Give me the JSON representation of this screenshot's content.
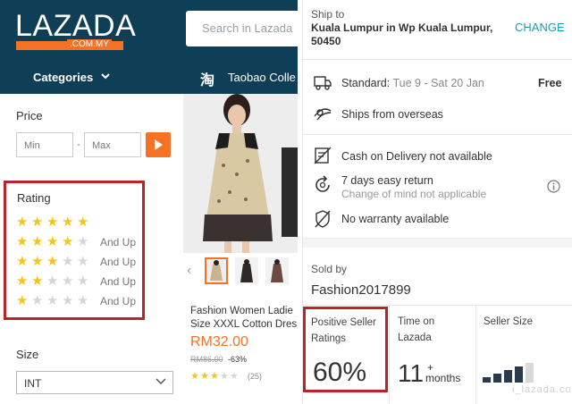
{
  "header": {
    "logo_text": "LAZADA",
    "logo_sub": ".COM.MY",
    "search_placeholder": "Search in Lazada",
    "categories_label": "Categories",
    "taobao_icon_glyph": "淘",
    "taobao_label": "Taobao Colle"
  },
  "filters": {
    "price_title": "Price",
    "price_min_placeholder": "Min",
    "price_max_placeholder": "Max",
    "price_dash": "-",
    "rating_title": "Rating",
    "rating_options": [
      {
        "stars": 5,
        "suffix": ""
      },
      {
        "stars": 4,
        "suffix": "And Up"
      },
      {
        "stars": 3,
        "suffix": "And Up"
      },
      {
        "stars": 2,
        "suffix": "And Up"
      },
      {
        "stars": 1,
        "suffix": "And Up"
      }
    ],
    "size_title": "Size",
    "size_selected": "INT"
  },
  "product": {
    "name": "Fashion Women Ladie Size XXXL Cotton Dres",
    "price": "RM32.00",
    "old_price": "RM86.00",
    "discount": "-63%",
    "rating_stars": 3,
    "reviews": "(25)"
  },
  "shipping": {
    "ship_to_label": "Ship to",
    "address": "Kuala Lumpur in Wp Kuala Lumpur, 50450",
    "change_label": "CHANGE",
    "standard_label": "Standard:",
    "standard_dates": "Tue 9 - Sat 20 Jan",
    "standard_price": "Free",
    "overseas": "Ships from overseas",
    "cod": "Cash on Delivery not available",
    "return_title": "7 days easy return",
    "return_sub": "Change of mind not applicable",
    "warranty": "No warranty available"
  },
  "seller": {
    "sold_by_label": "Sold by",
    "name": "Fashion2017899",
    "positive_title_1": "Positive Seller",
    "positive_title_2": "Ratings",
    "positive_value": "60%",
    "time_title_1": "Time on",
    "time_title_2": "Lazada",
    "time_value": "11",
    "time_plus": "+",
    "time_unit": "months",
    "size_title": "Seller Size",
    "size_level": 4,
    "size_max": 5
  },
  "colors": {
    "brand_navy": "#0f3f57",
    "brand_orange": "#f57224",
    "highlight_red": "#b9232a",
    "link_teal": "#1a9cb7",
    "star_gold": "#f5c518"
  },
  "watermark": "i_lazada.com"
}
